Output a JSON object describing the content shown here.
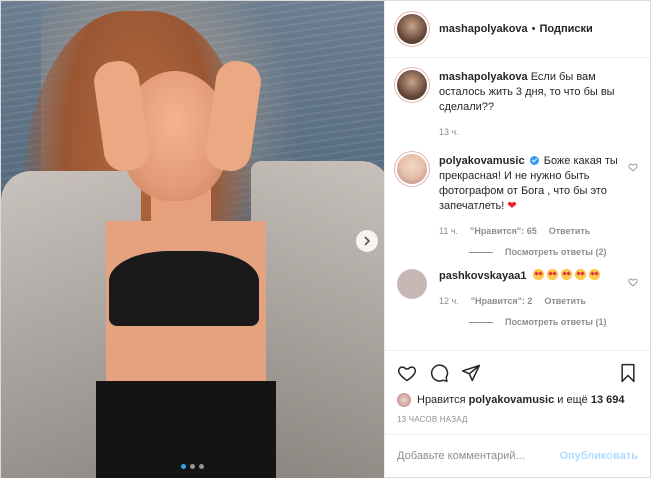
{
  "header": {
    "username": "mashapolyakova",
    "separator": "•",
    "follow_label": "Подписки"
  },
  "caption": {
    "username": "mashapolyakova",
    "text": "Если бы вам осталось жить 3 дня, то что бы вы сделали??",
    "time": "13 ч."
  },
  "comments": [
    {
      "username": "polyakovamusic",
      "verified": true,
      "text": "Боже какая ты прекрасная! И не нужно быть фотографом от Бога , что бы это запечатлеть!",
      "emoji": "red-heart",
      "time": "11 ч.",
      "likes": "\"Нравится\": 65",
      "reply_label": "Ответить",
      "view_replies": "Посмотреть ответы (2)"
    },
    {
      "username": "pashkovskayaa1",
      "verified": false,
      "emoji_count": 5,
      "emoji": "heart-eyes",
      "time": "12 ч.",
      "likes": "\"Нравится\": 2",
      "reply_label": "Ответить",
      "view_replies": "Посмотреть ответы (1)"
    }
  ],
  "likes_line": {
    "prefix": "Нравится",
    "user": "polyakovamusic",
    "suffix": "и ещё",
    "count": "13 694"
  },
  "post_time": "13 ЧАСОВ НАЗАД",
  "comment_input": {
    "placeholder": "Добавьте комментарий...",
    "publish_label": "Опубликовать"
  },
  "carousel": {
    "slide_count": 3,
    "active_index": 0
  },
  "icons": [
    "heart-icon",
    "comment-icon",
    "share-icon",
    "bookmark-icon",
    "next-arrow-icon"
  ],
  "colors": {
    "verified": "#3897f0",
    "publish": "#b3dbff",
    "carousel_active": "#2ea8f5",
    "red_heart": "#ed1c24"
  }
}
